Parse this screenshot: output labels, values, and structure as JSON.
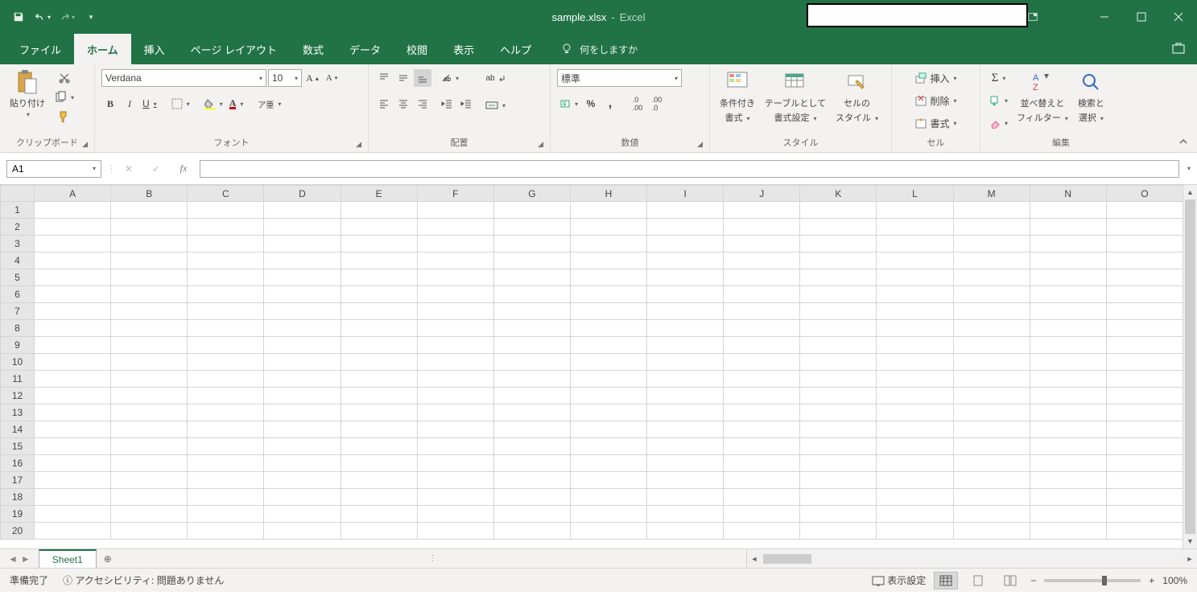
{
  "titlebar": {
    "filename": "sample.xlsx",
    "separator": "-",
    "app": "Excel"
  },
  "tabs": {
    "file": "ファイル",
    "home": "ホーム",
    "insert": "挿入",
    "pageLayout": "ページ レイアウト",
    "formulas": "数式",
    "data": "データ",
    "review": "校閲",
    "view": "表示",
    "help": "ヘルプ",
    "tellMe": "何をしますか"
  },
  "ribbon": {
    "clipboard": {
      "label": "クリップボード",
      "paste": "貼り付け"
    },
    "font": {
      "label": "フォント",
      "name": "Verdana",
      "size": "10",
      "bold": "B",
      "italic": "I",
      "underline": "U"
    },
    "alignment": {
      "label": "配置",
      "wrap": "ab"
    },
    "number": {
      "label": "数値",
      "format": "標準",
      "percent": "%",
      "comma": ","
    },
    "styles": {
      "label": "スタイル",
      "conditional1": "条件付き",
      "conditional2": "書式",
      "table1": "テーブルとして",
      "table2": "書式設定",
      "cell1": "セルの",
      "cell2": "スタイル"
    },
    "cells": {
      "label": "セル",
      "insert": "挿入",
      "delete": "削除",
      "format": "書式"
    },
    "editing": {
      "label": "編集",
      "sort1": "並べ替えと",
      "sort2": "フィルター",
      "find1": "検索と",
      "find2": "選択"
    }
  },
  "formulaBar": {
    "cellRef": "A1",
    "fx": "fx",
    "value": ""
  },
  "grid": {
    "columns": [
      "A",
      "B",
      "C",
      "D",
      "E",
      "F",
      "G",
      "H",
      "I",
      "J",
      "K",
      "L",
      "M",
      "N",
      "O"
    ],
    "rows": [
      1,
      2,
      3,
      4,
      5,
      6,
      7,
      8,
      9,
      10,
      11,
      12,
      13,
      14,
      15,
      16,
      17,
      18,
      19,
      20
    ]
  },
  "sheetTabs": {
    "sheet1": "Sheet1"
  },
  "status": {
    "ready": "準備完了",
    "accessibility": "アクセシビリティ: 問題ありません",
    "displaySettings": "表示設定",
    "zoom": "100%"
  }
}
